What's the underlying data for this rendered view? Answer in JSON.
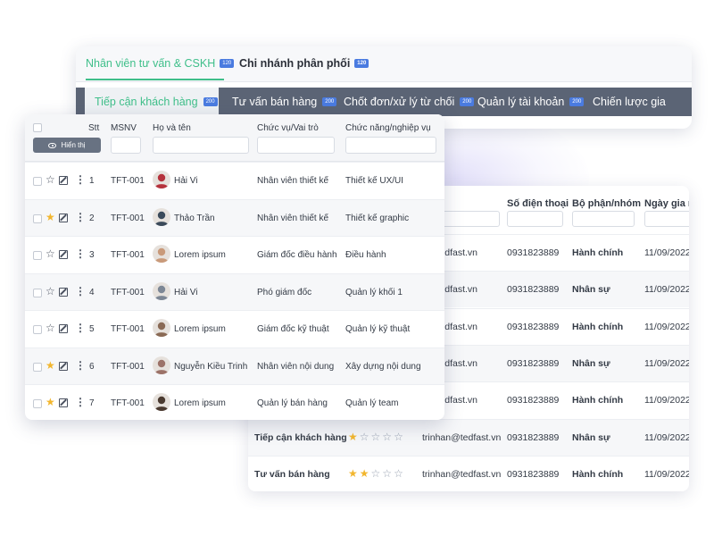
{
  "top_tabs": [
    {
      "label": "Nhân viên tư vấn & CSKH",
      "badge": "120"
    },
    {
      "label": "Chi nhánh phân phối",
      "badge": "120"
    }
  ],
  "sub_tabs": [
    {
      "label": "Tiếp cận khách hàng",
      "badge": "200"
    },
    {
      "label": "Tư vấn bán hàng",
      "badge": "200"
    },
    {
      "label": "Chốt đơn/xử lý từ chối",
      "badge": "200"
    },
    {
      "label": "Quản lý tài khoản",
      "badge": "200"
    },
    {
      "label": "Chiến lược gia",
      "badge": ""
    }
  ],
  "back_table": {
    "headers": {
      "phone": "Số điện thoại",
      "dept": "Bộ phận/nhóm",
      "date": "Ngày gia n"
    },
    "rows": [
      {
        "role": "",
        "email": "n@tedfast.vn",
        "phone": "0931823889",
        "dept": "Hành chính",
        "date": "11/09/2022"
      },
      {
        "role": "",
        "email": "n@tedfast.vn",
        "phone": "0931823889",
        "dept": "Nhân sự",
        "date": "11/09/2022"
      },
      {
        "role": "",
        "email": "n@tedfast.vn",
        "phone": "0931823889",
        "dept": "Hành chính",
        "date": "11/09/2022"
      },
      {
        "role": "",
        "email": "n@tedfast.vn",
        "phone": "0931823889",
        "dept": "Nhân sự",
        "date": "11/09/2022"
      },
      {
        "role": "",
        "email": "n@tedfast.vn",
        "phone": "0931823889",
        "dept": "Hành chính",
        "date": "11/09/2022"
      },
      {
        "role": "Tiếp cận khách hàng",
        "stars": 1,
        "email": "trinhan@tedfast.vn",
        "phone": "0931823889",
        "dept": "Nhân sự",
        "date": "11/09/2022"
      },
      {
        "role": "Tư vấn bán hàng",
        "stars": 2,
        "email": "trinhan@tedfast.vn",
        "phone": "0931823889",
        "dept": "Hành chính",
        "date": "11/09/2022"
      }
    ]
  },
  "front_table": {
    "show_button": "Hiển thị",
    "headers": {
      "stt": "Stt",
      "msnv": "MSNV",
      "name": "Họ và tên",
      "position": "Chức vụ/Vai trò",
      "function": "Chức năng/nghiệp vụ"
    },
    "rows": [
      {
        "starred": false,
        "stt": "1",
        "msnv": "TFT-001",
        "name": "Hải Vi",
        "position": "Nhân  viên thiết kế",
        "function": "Thiết kế UX/UI",
        "avatar_color": "#b5323c"
      },
      {
        "starred": true,
        "stt": "2",
        "msnv": "TFT-001",
        "name": "Thảo Trần",
        "position": "Nhân  viên thiết kế",
        "function": "Thiết kế graphic",
        "avatar_color": "#3b4a5a"
      },
      {
        "starred": false,
        "stt": "3",
        "msnv": "TFT-001",
        "name": "Lorem ipsum",
        "position": "Giám đốc điều hành",
        "function": "Điều hành",
        "avatar_color": "#c99a7a"
      },
      {
        "starred": false,
        "stt": "4",
        "msnv": "TFT-001",
        "name": "Hải Vi",
        "position": "Phó giám đốc",
        "function": "Quản lý khối 1",
        "avatar_color": "#7d8795"
      },
      {
        "starred": false,
        "stt": "5",
        "msnv": "TFT-001",
        "name": "Lorem ipsum",
        "position": "Giám đốc kỹ thuật",
        "function": "Quản lý kỹ thuật",
        "avatar_color": "#8a6a55"
      },
      {
        "starred": true,
        "stt": "6",
        "msnv": "TFT-001",
        "name": "Nguyễn Kiều Trinh",
        "position": "Nhân viên nội dung",
        "function": "Xây dựng nội dung",
        "avatar_color": "#9c7268"
      },
      {
        "starred": true,
        "stt": "7",
        "msnv": "TFT-001",
        "name": "Lorem ipsum",
        "position": "Quản lý bán hàng",
        "function": "Quản lý team",
        "avatar_color": "#4a3a30"
      }
    ]
  },
  "colors": {
    "accent": "#3fbf8a",
    "badge": "#4a7be0",
    "subtab_bg": "#5b6475",
    "star_on": "#f2b62e",
    "star_off": "#9aa3b2"
  }
}
